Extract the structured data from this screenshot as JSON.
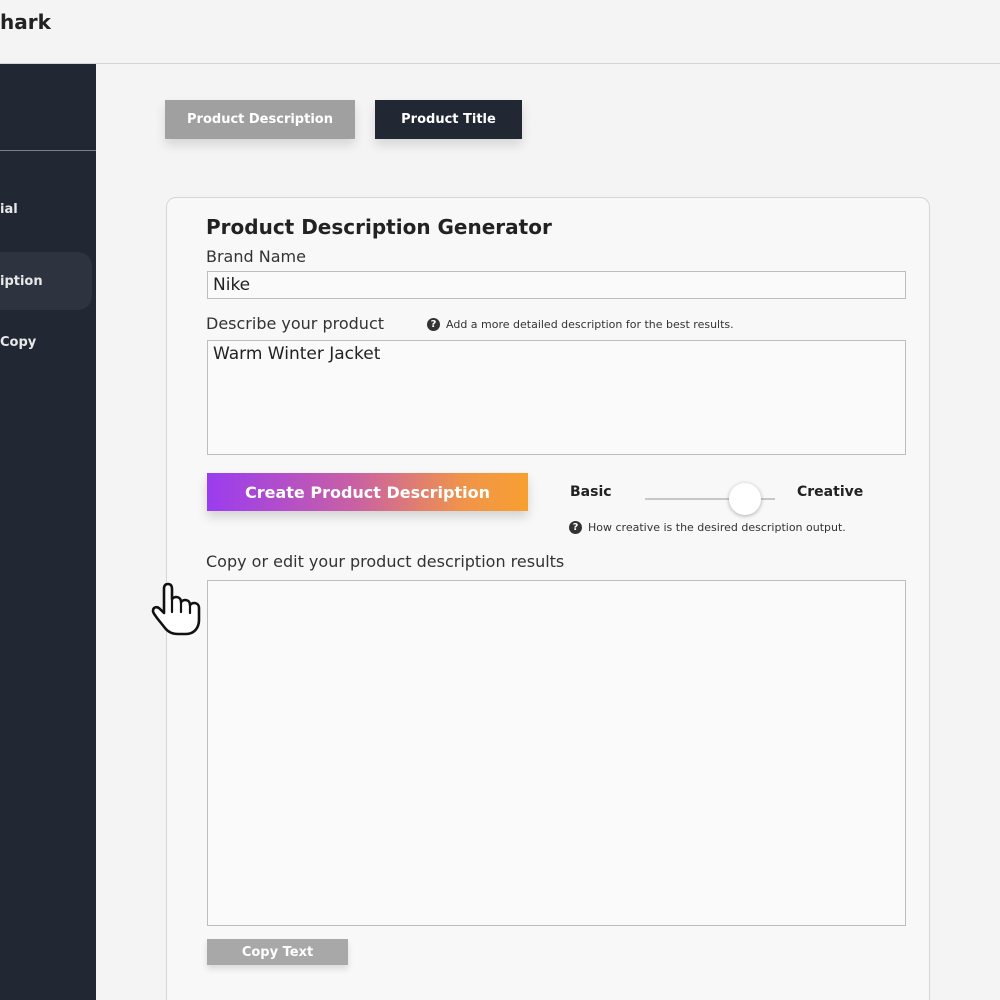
{
  "app": {
    "logo_text": "hark"
  },
  "sidebar": {
    "items": [
      {
        "label": "ial"
      },
      {
        "label": "iption"
      },
      {
        "label": "Copy"
      }
    ]
  },
  "tabs": [
    {
      "label": "Product Description",
      "active": false
    },
    {
      "label": "Product Title",
      "active": true
    }
  ],
  "form": {
    "title": "Product Description Generator",
    "brand_label": "Brand Name",
    "brand_value": "Nike",
    "describe_label": "Describe your product",
    "describe_hint": "Add a more detailed description for the best results.",
    "describe_value": "Warm Winter Jacket",
    "create_button": "Create Product Description",
    "slider": {
      "min_label": "Basic",
      "max_label": "Creative",
      "hint": "How creative is the desired description output.",
      "value_fraction": 0.77
    },
    "results_label": "Copy or edit your product description results",
    "results_value": "",
    "copy_button": "Copy Text"
  },
  "colors": {
    "sidebar_bg": "#222833",
    "gradient_start": "#9a3cf0",
    "gradient_end": "#f7a030",
    "inactive_tab": "#a0a0a0"
  },
  "icons": [
    "question-circle-icon",
    "hand-pointer-cursor-icon"
  ]
}
